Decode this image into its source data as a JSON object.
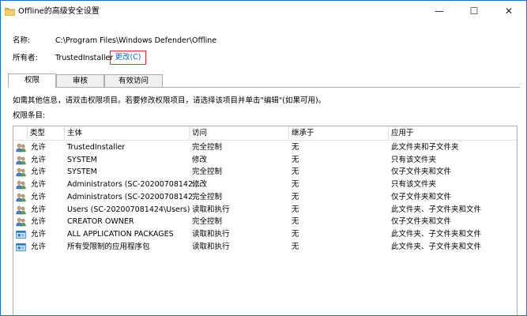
{
  "window": {
    "title": "Offline的高级安全设置",
    "minimize_glyph": "—",
    "maximize_glyph": "☐",
    "close_glyph": "✕"
  },
  "info": {
    "name_label": "名称:",
    "name_value": "C:\\Program Files\\Windows Defender\\Offline",
    "owner_label": "所有者:",
    "owner_value": "TrustedInstaller",
    "change_label": "更改(C)"
  },
  "tabs": [
    {
      "label": "权限",
      "active": true
    },
    {
      "label": "审核",
      "active": false
    },
    {
      "label": "有效访问",
      "active": false
    }
  ],
  "instructions": "如需其他信息，请双击权限项目。若要修改权限项目，请选择该项目并单击\"编辑\"(如果可用)。",
  "entries_label": "权限条目:",
  "table": {
    "columns": [
      "类型",
      "主体",
      "访问",
      "继承于",
      "应用于"
    ],
    "rows": [
      {
        "icon": "users-icon",
        "type": "允许",
        "principal": "TrustedInstaller",
        "access": "完全控制",
        "inherited": "无",
        "applies": "此文件夹和子文件夹"
      },
      {
        "icon": "users-icon",
        "type": "允许",
        "principal": "SYSTEM",
        "access": "修改",
        "inherited": "无",
        "applies": "只有该文件夹"
      },
      {
        "icon": "users-icon",
        "type": "允许",
        "principal": "SYSTEM",
        "access": "完全控制",
        "inherited": "无",
        "applies": "仅子文件夹和文件"
      },
      {
        "icon": "users-icon",
        "type": "允许",
        "principal": "Administrators (SC-20200708142...",
        "access": "修改",
        "inherited": "无",
        "applies": "只有该文件夹"
      },
      {
        "icon": "users-icon",
        "type": "允许",
        "principal": "Administrators (SC-20200708142...",
        "access": "完全控制",
        "inherited": "无",
        "applies": "仅子文件夹和文件"
      },
      {
        "icon": "users-icon",
        "type": "允许",
        "principal": "Users (SC-202007081424\\Users)",
        "access": "读取和执行",
        "inherited": "无",
        "applies": "此文件夹、子文件夹和文件"
      },
      {
        "icon": "users-icon",
        "type": "允许",
        "principal": "CREATOR OWNER",
        "access": "完全控制",
        "inherited": "无",
        "applies": "仅子文件夹和文件"
      },
      {
        "icon": "app-package-icon",
        "type": "允许",
        "principal": "ALL APPLICATION PACKAGES",
        "access": "读取和执行",
        "inherited": "无",
        "applies": "此文件夹、子文件夹和文件"
      },
      {
        "icon": "app-package-icon",
        "type": "允许",
        "principal": "所有受限制的应用程序包",
        "access": "读取和执行",
        "inherited": "无",
        "applies": "此文件夹、子文件夹和文件"
      }
    ]
  }
}
